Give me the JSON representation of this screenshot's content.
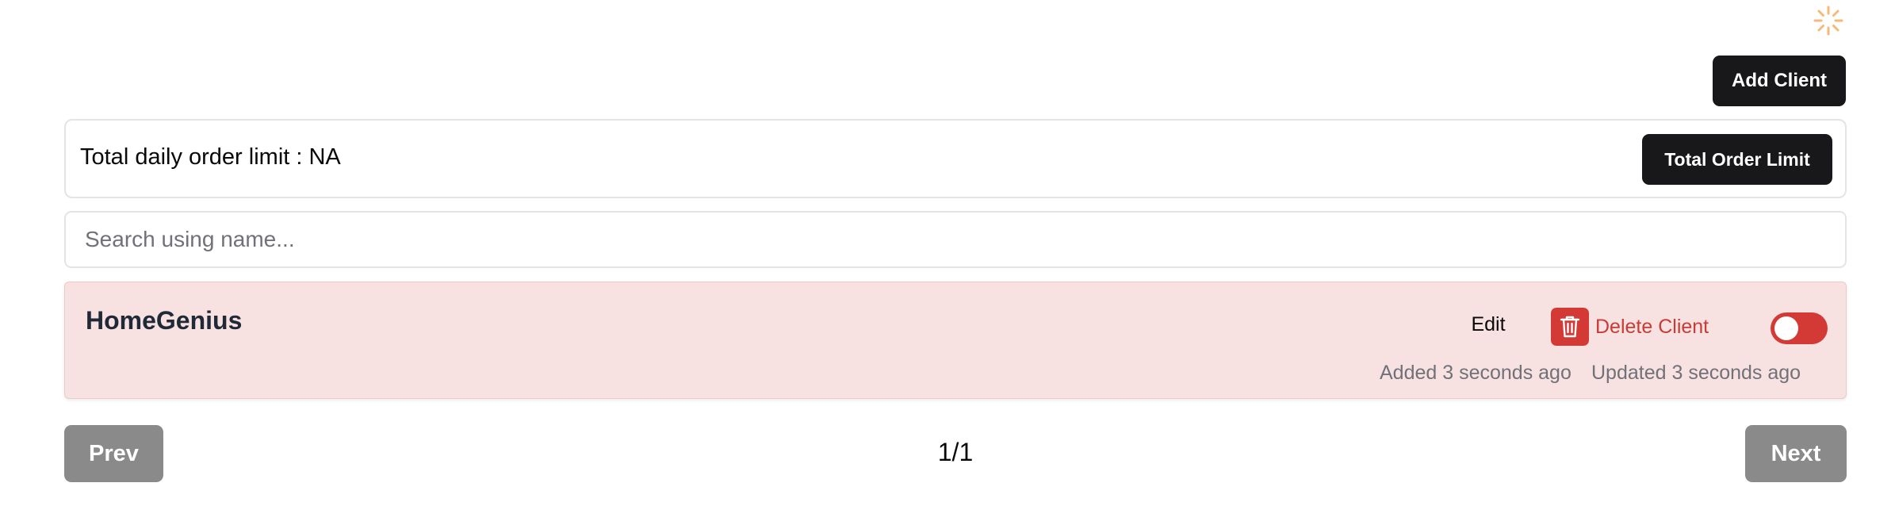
{
  "header": {
    "add_client_label": "Add Client"
  },
  "limits": {
    "total_daily_label": "Total daily order limit : NA",
    "total_limit_button": "Total Order Limit"
  },
  "search": {
    "placeholder": "Search using name...",
    "value": ""
  },
  "clients": [
    {
      "name": "HomeGenius",
      "edit_label": "Edit",
      "delete_label": "Delete Client",
      "enabled": false,
      "added": "Added 3 seconds ago",
      "updated": "Updated 3 seconds ago"
    }
  ],
  "pagination": {
    "prev_label": "Prev",
    "next_label": "Next",
    "indicator": "1/1"
  },
  "colors": {
    "primary_button": "#18181b",
    "danger": "#d33a36",
    "card_background": "#f7e1e1",
    "disabled_button": "#8a8a8a",
    "spinner": "#f5b979"
  },
  "icons": {
    "loading": "spinner-icon",
    "delete": "trash-icon"
  }
}
